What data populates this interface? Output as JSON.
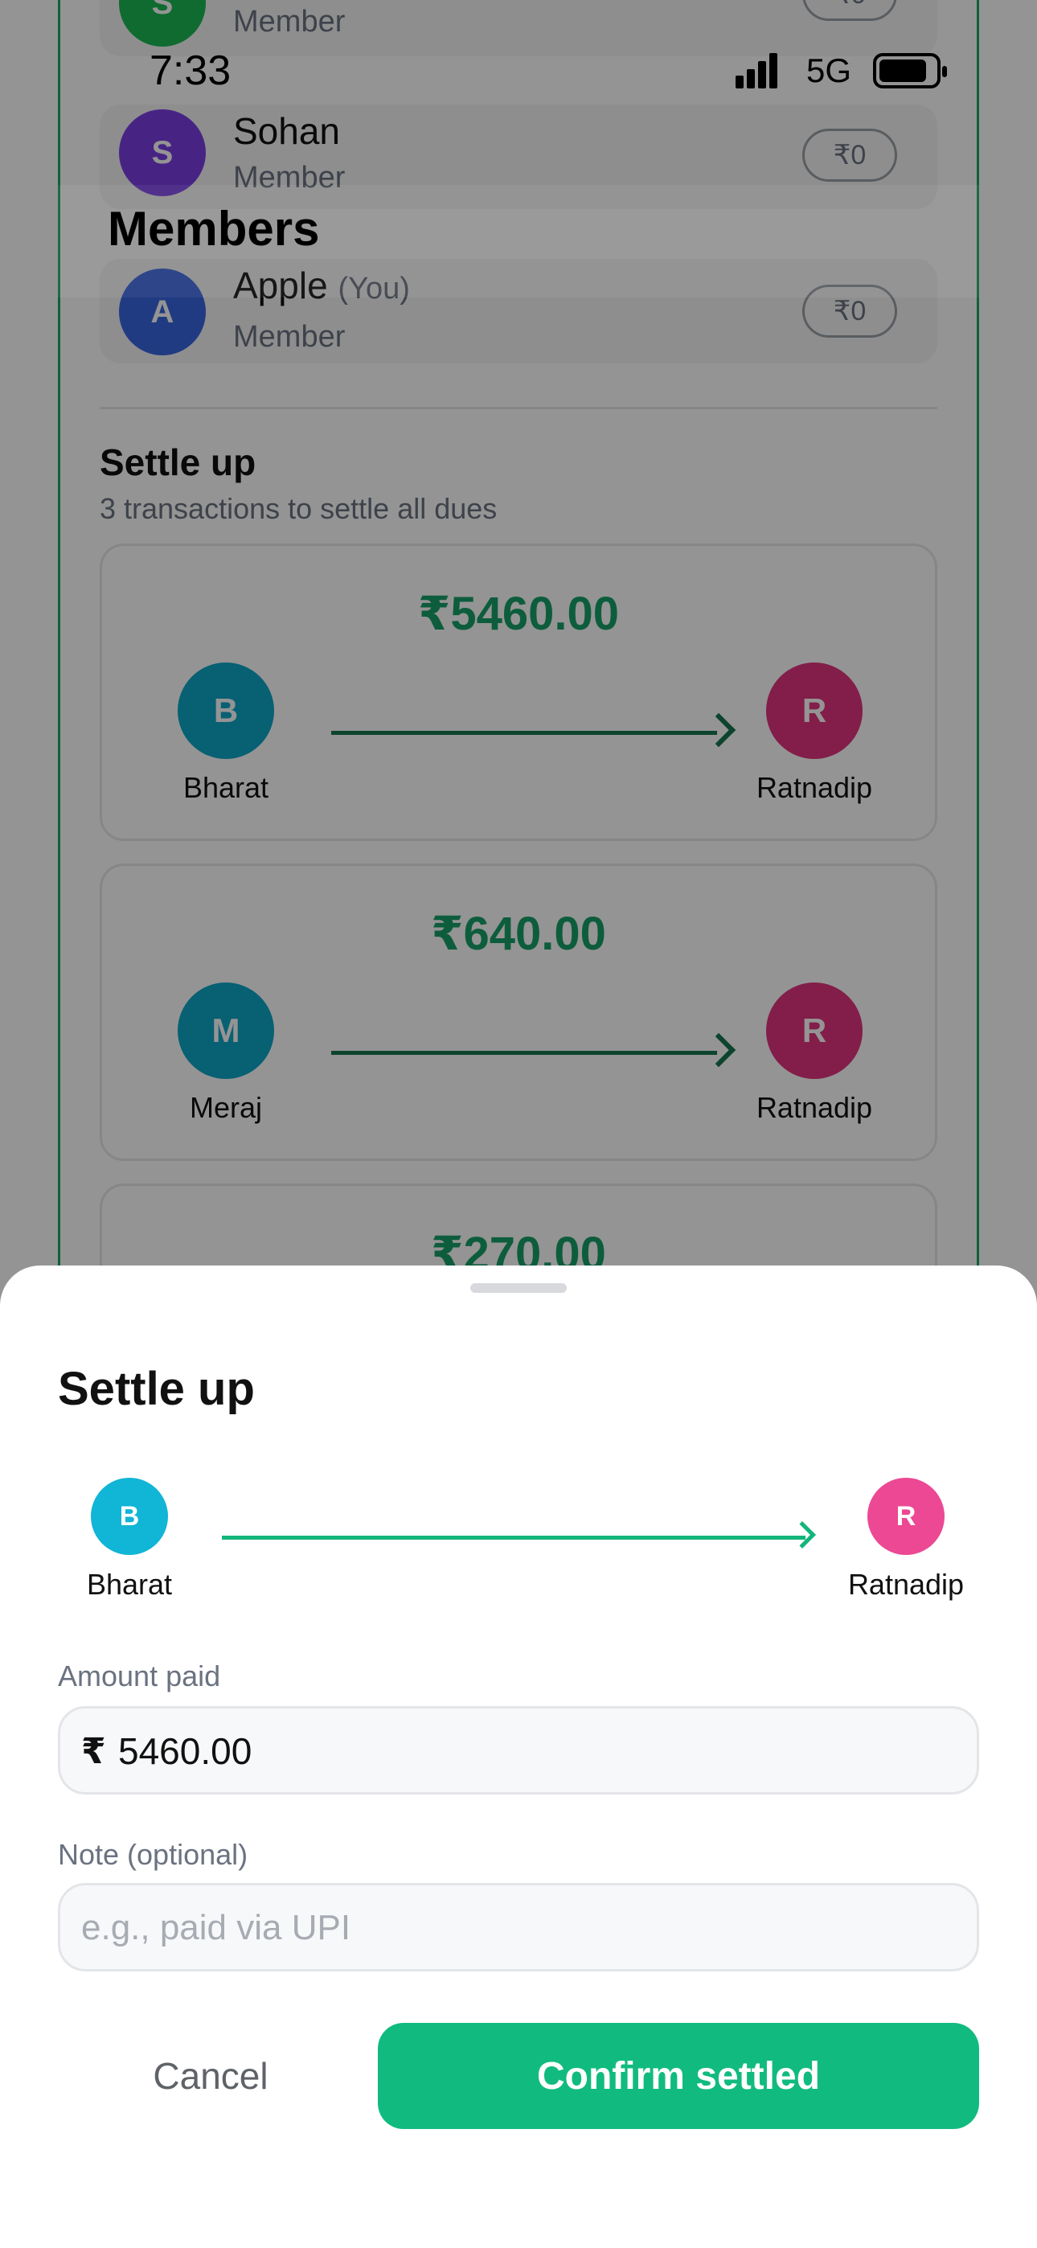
{
  "status_bar": {
    "time": "7:33",
    "network": "5G"
  },
  "members_header": {
    "title": "Members"
  },
  "members": [
    {
      "initial": "S",
      "name": "",
      "role": "Member",
      "balance": "₹0",
      "color": "#1db954"
    },
    {
      "initial": "S",
      "name": "Sohan",
      "role": "Member",
      "balance": "₹0",
      "color": "#7b3fe4"
    },
    {
      "initial": "A",
      "name": "Apple",
      "you_tag": "(You)",
      "role": "Member",
      "balance": "₹0",
      "color": "#3a66e0"
    }
  ],
  "settle_section": {
    "title": "Settle up",
    "subtitle": "3 transactions to settle all dues",
    "transactions": [
      {
        "amount": "₹5460.00",
        "from_initial": "B",
        "from_name": "Bharat",
        "to_initial": "R",
        "to_name": "Ratnadip",
        "from_color": "#0ea5c6",
        "to_color": "#e0357e"
      },
      {
        "amount": "₹640.00",
        "from_initial": "M",
        "from_name": "Meraj",
        "to_initial": "R",
        "to_name": "Ratnadip",
        "from_color": "#0ea5c6",
        "to_color": "#e0357e"
      },
      {
        "amount": "₹270.00"
      }
    ]
  },
  "sheet": {
    "title": "Settle up",
    "from_initial": "B",
    "from_name": "Bharat",
    "to_initial": "R",
    "to_name": "Ratnadip",
    "from_color": "#11b5d6",
    "to_color": "#ec4893",
    "amount_label": "Amount paid",
    "currency_symbol": "₹",
    "amount_value": "5460.00",
    "note_label": "Note (optional)",
    "note_placeholder": "e.g., paid via UPI",
    "cancel_label": "Cancel",
    "confirm_label": "Confirm settled"
  },
  "colors": {
    "accent": "#11bb7f",
    "amount_green": "#17a06a"
  }
}
